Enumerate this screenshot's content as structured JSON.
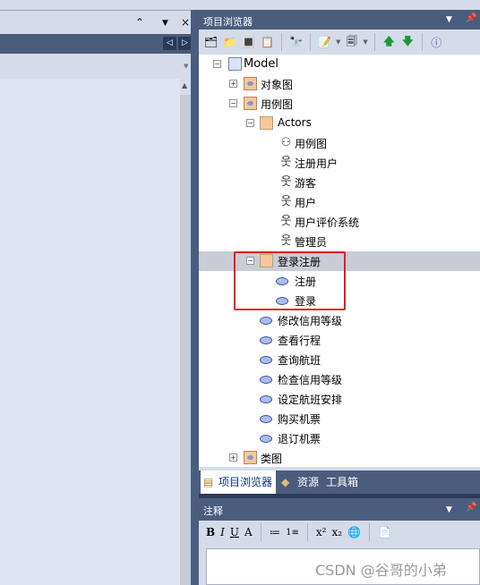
{
  "left_panel": {
    "collapse_icon": "double-chevron-up-icon",
    "menu_icon": "triangle-down-icon",
    "close_icon": "close-icon",
    "prev_icon": "arrow-left-icon",
    "next_icon": "arrow-right-icon"
  },
  "browser": {
    "title": "项目浏览器",
    "tree": [
      {
        "label": "Model",
        "level": 0,
        "toggle": "-",
        "icon": "model-icon"
      },
      {
        "label": "对象图",
        "level": 1,
        "toggle": "+",
        "icon": "diagram-package-icon"
      },
      {
        "label": "用例图",
        "level": 1,
        "toggle": "-",
        "icon": "diagram-package-icon"
      },
      {
        "label": "Actors",
        "level": 2,
        "toggle": "-",
        "icon": "folder-icon"
      },
      {
        "label": "用例图",
        "level": 3,
        "icon": "usecase-diagram-icon"
      },
      {
        "label": "注册用户",
        "level": 3,
        "icon": "actor-icon"
      },
      {
        "label": "游客",
        "level": 3,
        "icon": "actor-icon"
      },
      {
        "label": "用户",
        "level": 3,
        "icon": "actor-icon"
      },
      {
        "label": "用户评价系统",
        "level": 3,
        "icon": "actor-icon"
      },
      {
        "label": "管理员",
        "level": 3,
        "icon": "actor-icon"
      },
      {
        "label": "登录注册",
        "level": 2,
        "toggle": "-",
        "icon": "folder-icon",
        "selected": true
      },
      {
        "label": "注册",
        "level": 3,
        "icon": "usecase-icon"
      },
      {
        "label": "登录",
        "level": 3,
        "icon": "usecase-icon"
      },
      {
        "label": "修改信用等级",
        "level": 2,
        "icon": "usecase-icon"
      },
      {
        "label": "查看行程",
        "level": 2,
        "icon": "usecase-icon"
      },
      {
        "label": "查询航班",
        "level": 2,
        "icon": "usecase-icon"
      },
      {
        "label": "检查信用等级",
        "level": 2,
        "icon": "usecase-icon"
      },
      {
        "label": "设定航班安排",
        "level": 2,
        "icon": "usecase-icon"
      },
      {
        "label": "购买机票",
        "level": 2,
        "icon": "usecase-icon"
      },
      {
        "label": "退订机票",
        "level": 2,
        "icon": "usecase-icon"
      },
      {
        "label": "类图",
        "level": 1,
        "toggle": "+",
        "icon": "class-package-icon"
      }
    ],
    "tabs": [
      {
        "label": "项目浏览器",
        "active": true
      },
      {
        "label": "资源"
      },
      {
        "label": "工具箱"
      }
    ]
  },
  "notes": {
    "title": "注释",
    "toolbar": [
      "B",
      "I",
      "U",
      "A",
      "≔",
      "1≡",
      "x²",
      "x₂",
      "🌐",
      "📄"
    ]
  },
  "highlight_color": "#e02020",
  "watermark": "CSDN @谷哥的小弟"
}
